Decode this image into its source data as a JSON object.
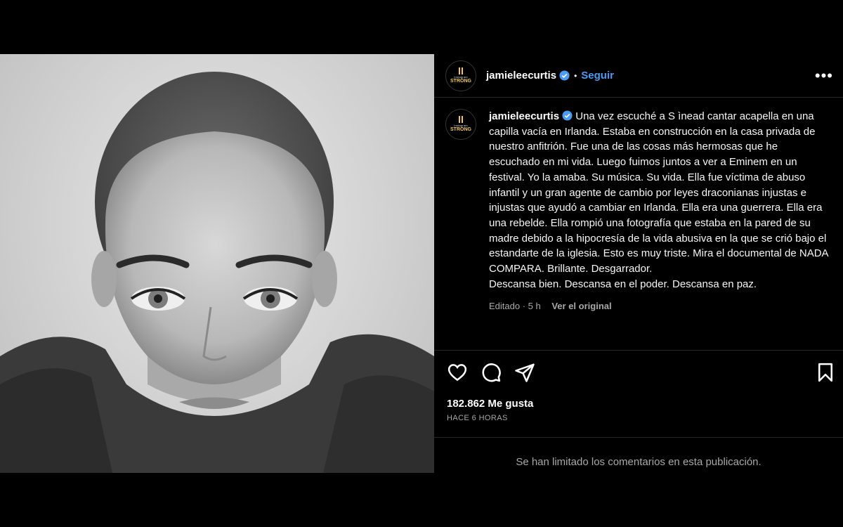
{
  "post": {
    "username": "jamieleecurtis",
    "follow_label": "Seguir",
    "separator": "•",
    "avatar": {
      "line1": "Instagram",
      "line2": "STRONG",
      "brand_color": "#f2c94c"
    },
    "caption": "Una vez escuché a S ìnead cantar acapella en una capilla vacía en Irlanda. Estaba en construcción en la casa privada de nuestro anfitrión. Fue una de las cosas más hermosas que he escuchado en mi vida. Luego fuimos juntos a ver a Eminem en un festival. Yo la amaba. Su música. Su vida. Ella fue víctima de abuso infantil y un gran agente de cambio por leyes draconianas injustas e injustas que ayudó a cambiar en Irlanda. Ella era una guerrera. Ella era una rebelde. Ella rompió una fotografía que estaba en la pared de su madre debido a la hipocresía de la vida abusiva en la que se crió bajo el estandarte de la iglesia. Esto es muy triste. Mira el documental de NADA COMPARA. Brillante. Desgarrador.\nDescansa bien. Descansa en el poder. Descansa en paz.",
    "edited_meta": "Editado · 5 h",
    "see_original": "Ver el original",
    "likes": "182.862 Me gusta",
    "timestamp": "HACE 6 HORAS",
    "comments_limited": "Se han limitado los comentarios en esta publicación."
  },
  "icons": {
    "more": "more-options-icon",
    "verified": "verified-badge-icon",
    "like": "heart-icon",
    "comment": "comment-icon",
    "share": "share-icon",
    "save": "bookmark-icon"
  },
  "colors": {
    "accent": "#4b9bf5",
    "background": "#000000",
    "muted": "#a8a8a8"
  }
}
